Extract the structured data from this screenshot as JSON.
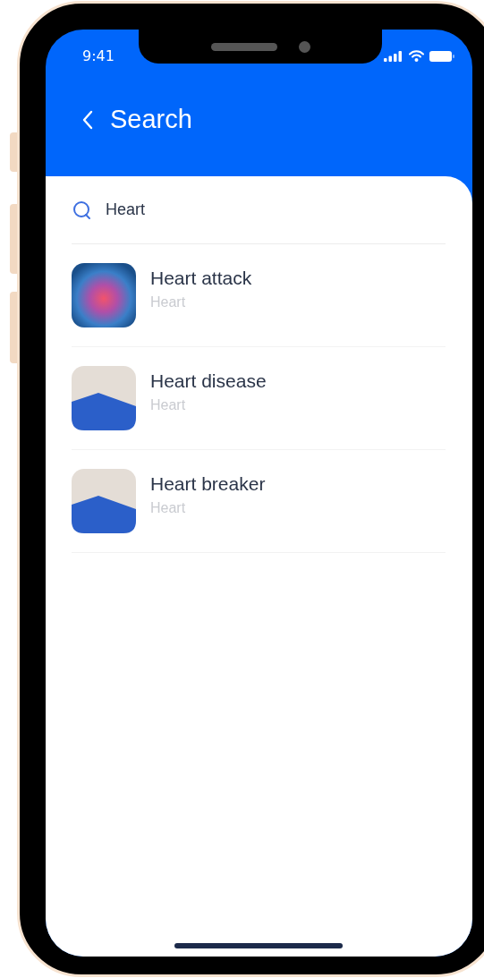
{
  "status_bar": {
    "time": "9:41"
  },
  "header": {
    "title": "Search"
  },
  "search": {
    "value": "Heart"
  },
  "results": [
    {
      "title": "Heart attack",
      "category": "Heart",
      "kind": "illustration"
    },
    {
      "title": "Heart disease",
      "category": "Heart",
      "kind": "photo"
    },
    {
      "title": "Heart breaker",
      "category": "Heart",
      "kind": "photo"
    }
  ]
}
